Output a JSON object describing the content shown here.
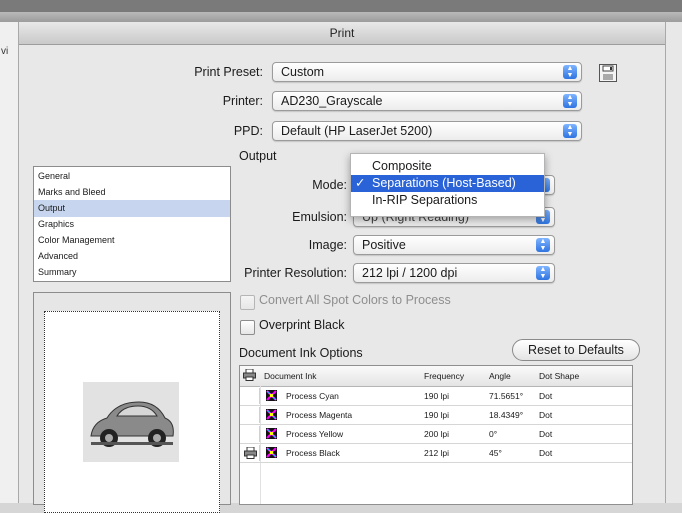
{
  "background": {
    "left_fragment": "vi"
  },
  "window": {
    "title": "Print"
  },
  "print_preset": {
    "label": "Print Preset:",
    "value": "Custom"
  },
  "printer": {
    "label": "Printer:",
    "value": "AD230_Grayscale"
  },
  "ppd": {
    "label": "PPD:",
    "value": "Default (HP LaserJet 5200)"
  },
  "section_title": "Output",
  "categories": [
    "General",
    "Marks and Bleed",
    "Output",
    "Graphics",
    "Color Management",
    "Advanced",
    "Summary"
  ],
  "selected_category": "Output",
  "mode": {
    "label": "Mode:",
    "options": [
      "Composite",
      "Separations (Host-Based)",
      "In-RIP Separations"
    ],
    "selected": "Separations (Host-Based)",
    "check_mark": "✓"
  },
  "emulsion": {
    "label": "Emulsion:",
    "value": "Up (Right Reading)"
  },
  "image": {
    "label": "Image:",
    "value": "Positive"
  },
  "printer_resolution": {
    "label": "Printer Resolution:",
    "value": "212 lpi / 1200 dpi"
  },
  "convert_spot": {
    "label": "Convert All Spot Colors to Process",
    "checked": false,
    "enabled": false
  },
  "overprint_black": {
    "label": "Overprint Black",
    "checked": false
  },
  "ink_options": {
    "title": "Document Ink Options",
    "reset_label": "Reset to Defaults",
    "columns": [
      "Document Ink",
      "Frequency",
      "Angle",
      "Dot Shape"
    ],
    "rows": [
      {
        "name": "Process Cyan",
        "frequency": "190 lpi",
        "angle": "71.5651°",
        "dot": "Dot",
        "print_enabled": false
      },
      {
        "name": "Process Magenta",
        "frequency": "190 lpi",
        "angle": "18.4349°",
        "dot": "Dot",
        "print_enabled": false
      },
      {
        "name": "Process Yellow",
        "frequency": "200 lpi",
        "angle": "0°",
        "dot": "Dot",
        "print_enabled": false
      },
      {
        "name": "Process Black",
        "frequency": "212 lpi",
        "angle": "45°",
        "dot": "Dot",
        "print_enabled": true
      }
    ]
  },
  "colors": {
    "selection": "#2a63d8",
    "list_selection": "#c7d6ee",
    "stepper": "#2e74e0"
  },
  "icons": {
    "save": "save-icon",
    "printer": "printer-icon",
    "swatch": "process-ink-swatch-icon",
    "stepper": "popup-stepper-icon"
  }
}
